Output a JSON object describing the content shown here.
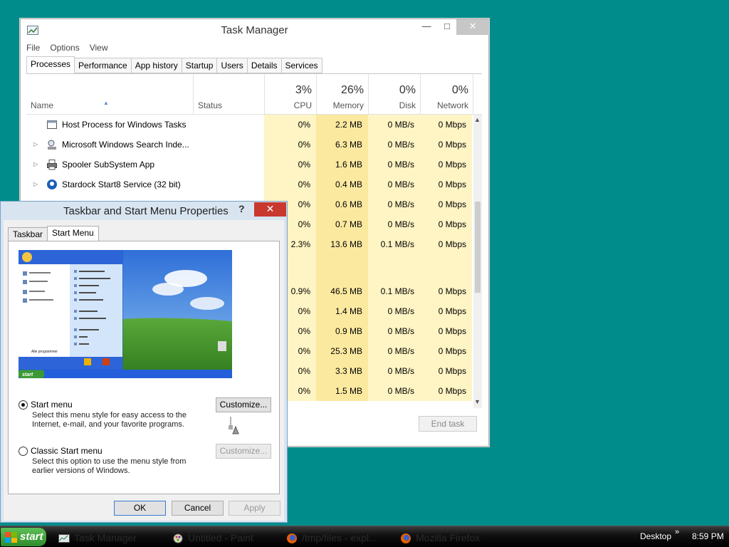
{
  "task_manager": {
    "title": "Task Manager",
    "menu": [
      "File",
      "Options",
      "View"
    ],
    "tabs": [
      "Processes",
      "Performance",
      "App history",
      "Startup",
      "Users",
      "Details",
      "Services"
    ],
    "active_tab": "Processes",
    "columns": {
      "name": "Name",
      "status": "Status",
      "cpu": {
        "pct": "3%",
        "label": "CPU"
      },
      "memory": {
        "pct": "26%",
        "label": "Memory"
      },
      "disk": {
        "pct": "0%",
        "label": "Disk"
      },
      "network": {
        "pct": "0%",
        "label": "Network"
      }
    },
    "rows": [
      {
        "name": "Host Process for Windows Tasks",
        "icon": "window-process-icon",
        "expand": false,
        "cpu": "0%",
        "mem": "2.2 MB",
        "disk": "0 MB/s",
        "net": "0 Mbps"
      },
      {
        "name": "Microsoft Windows Search Inde...",
        "icon": "search-indexer-icon",
        "expand": true,
        "cpu": "0%",
        "mem": "6.3 MB",
        "disk": "0 MB/s",
        "net": "0 Mbps"
      },
      {
        "name": "Spooler SubSystem App",
        "icon": "printer-icon",
        "expand": true,
        "cpu": "0%",
        "mem": "1.6 MB",
        "disk": "0 MB/s",
        "net": "0 Mbps"
      },
      {
        "name": "Stardock Start8 Service (32 bit)",
        "icon": "stardock-icon",
        "expand": true,
        "cpu": "0%",
        "mem": "0.4 MB",
        "disk": "0 MB/s",
        "net": "0 Mbps"
      },
      {
        "name": "",
        "icon": "",
        "expand": false,
        "cpu": "0%",
        "mem": "0.6 MB",
        "disk": "0 MB/s",
        "net": "0 Mbps"
      },
      {
        "name": "",
        "icon": "",
        "expand": false,
        "cpu": "0%",
        "mem": "0.7 MB",
        "disk": "0 MB/s",
        "net": "0 Mbps"
      },
      {
        "name": "",
        "icon": "",
        "expand": false,
        "cpu": "2.3%",
        "mem": "13.6 MB",
        "disk": "0.1 MB/s",
        "net": "0 Mbps"
      },
      {
        "name": "",
        "icon": "",
        "expand": false,
        "cpu": "",
        "mem": "",
        "disk": "",
        "net": "",
        "group_gap": true
      },
      {
        "name": "",
        "icon": "",
        "expand": false,
        "cpu": "0.9%",
        "mem": "46.5 MB",
        "disk": "0.1 MB/s",
        "net": "0 Mbps"
      },
      {
        "name": "",
        "icon": "",
        "expand": false,
        "cpu": "0%",
        "mem": "1.4 MB",
        "disk": "0 MB/s",
        "net": "0 Mbps"
      },
      {
        "name": "",
        "icon": "",
        "expand": false,
        "cpu": "0%",
        "mem": "0.9 MB",
        "disk": "0 MB/s",
        "net": "0 Mbps"
      },
      {
        "name": "",
        "icon": "",
        "expand": false,
        "cpu": "0%",
        "mem": "25.3 MB",
        "disk": "0 MB/s",
        "net": "0 Mbps"
      },
      {
        "name": "",
        "icon": "",
        "expand": false,
        "cpu": "0%",
        "mem": "3.3 MB",
        "disk": "0 MB/s",
        "net": "0 Mbps"
      },
      {
        "name": "",
        "icon": "",
        "expand": false,
        "cpu": "0%",
        "mem": "1.5 MB",
        "disk": "0 MB/s",
        "net": "0 Mbps"
      }
    ],
    "end_task": "End task"
  },
  "taskbar_dialog": {
    "title": "Taskbar and Start Menu Properties",
    "help": "?",
    "tabs": [
      "Taskbar",
      "Start Menu"
    ],
    "active_tab": "Start Menu",
    "preview": {
      "all_programs": "Alle programmer",
      "start_label": "start"
    },
    "start_menu": {
      "label": "Start menu",
      "desc": "Select this menu style for easy access to the Internet, e-mail, and your favorite programs.",
      "customize": "Customize...",
      "selected": true
    },
    "classic_menu": {
      "label": "Classic Start menu",
      "desc": "Select this option to use the menu style from earlier versions of Windows.",
      "customize": "Customize...",
      "selected": false
    },
    "buttons": {
      "ok": "OK",
      "cancel": "Cancel",
      "apply": "Apply"
    }
  },
  "taskbar": {
    "start": "start",
    "items": [
      {
        "label": "Task Manager",
        "icon": "task-manager-icon"
      },
      {
        "label": "Untitled - Paint",
        "icon": "paint-icon"
      },
      {
        "label": "/tmp/files - expl...",
        "icon": "firefox-icon"
      },
      {
        "label": "Mozilla Firefox",
        "icon": "firefox-icon"
      }
    ],
    "desktop": "Desktop",
    "chevron": "»",
    "clock": "8:59 PM"
  }
}
